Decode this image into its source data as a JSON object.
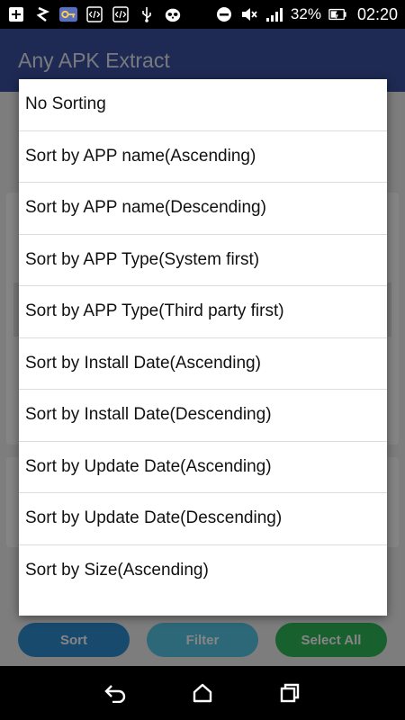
{
  "status_bar": {
    "battery_percent": "32%",
    "time": "02:20",
    "icons": [
      "add-box-icon",
      "s-logo-icon",
      "key-icon",
      "code-icon",
      "code-icon-2",
      "usb-icon",
      "raccoon-icon",
      "dnd-icon",
      "mute-icon",
      "signal-icon",
      "battery-icon"
    ]
  },
  "app_bar": {
    "title": "Any APK Extract"
  },
  "background": {
    "buttons": {
      "sort": "Sort",
      "filter": "Filter",
      "select_all": "Select All"
    },
    "colors": {
      "sort": "#2f8ed3",
      "filter": "#57c7e6",
      "select_all": "#31b85a",
      "app_bar": "#3b529f"
    }
  },
  "sort_menu": {
    "items": [
      "No Sorting",
      "Sort by APP name(Ascending)",
      "Sort by APP name(Descending)",
      "Sort by APP Type(System first)",
      "Sort by APP Type(Third party first)",
      "Sort by Install Date(Ascending)",
      "Sort by Install Date(Descending)",
      "Sort by Update Date(Ascending)",
      "Sort by Update Date(Descending)",
      "Sort by Size(Ascending)"
    ]
  },
  "nav_bar": {
    "icons": [
      "back-icon",
      "home-icon",
      "recents-icon"
    ]
  }
}
